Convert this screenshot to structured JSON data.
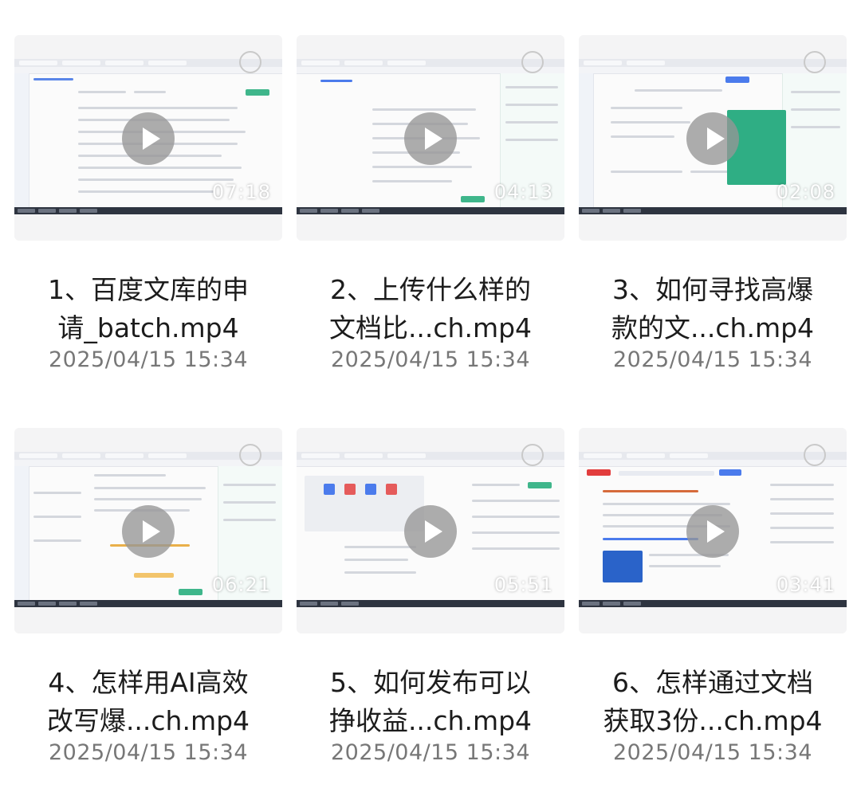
{
  "videos": [
    {
      "title_line1": "1、百度文库的申",
      "title_line2": "请_batch.mp4",
      "date": "2025/04/15 15:34",
      "duration": "07:18"
    },
    {
      "title_line1": "2、上传什么样的",
      "title_line2": "文档比...ch.mp4",
      "date": "2025/04/15 15:34",
      "duration": "04:13"
    },
    {
      "title_line1": "3、如何寻找高爆",
      "title_line2": "款的文...ch.mp4",
      "date": "2025/04/15 15:34",
      "duration": "02:08"
    },
    {
      "title_line1": "4、怎样用AI高效",
      "title_line2": "改写爆...ch.mp4",
      "date": "2025/04/15 15:34",
      "duration": "06:21"
    },
    {
      "title_line1": "5、如何发布可以",
      "title_line2": "挣收益...ch.mp4",
      "date": "2025/04/15 15:34",
      "duration": "05:51"
    },
    {
      "title_line1": "6、怎样通过文档",
      "title_line2": "获取3份...ch.mp4",
      "date": "2025/04/15 15:34",
      "duration": "03:41"
    }
  ],
  "icons": {
    "play": "play-icon",
    "record": "record-circle-icon"
  }
}
